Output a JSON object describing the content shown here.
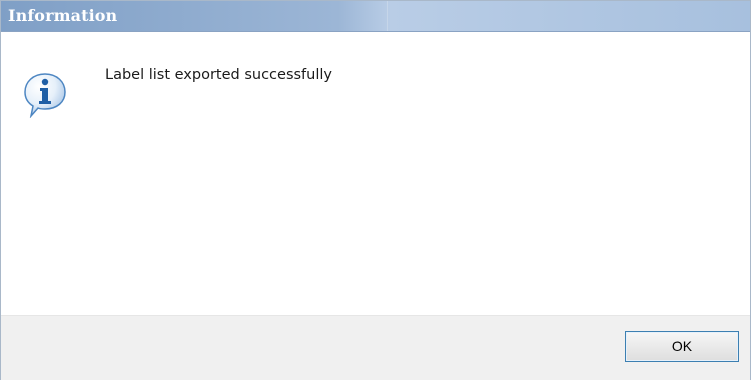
{
  "dialog": {
    "title": "Information",
    "message": "Label list exported successfully",
    "icon": "info-icon",
    "buttons": {
      "ok_label": "OK"
    }
  },
  "colors": {
    "title_bar": "#9cb6d6",
    "title_text": "#ffffff",
    "footer": "#f0f0f0",
    "button_border": "#3c7fb1",
    "icon_blue": "#2f7bc4"
  }
}
